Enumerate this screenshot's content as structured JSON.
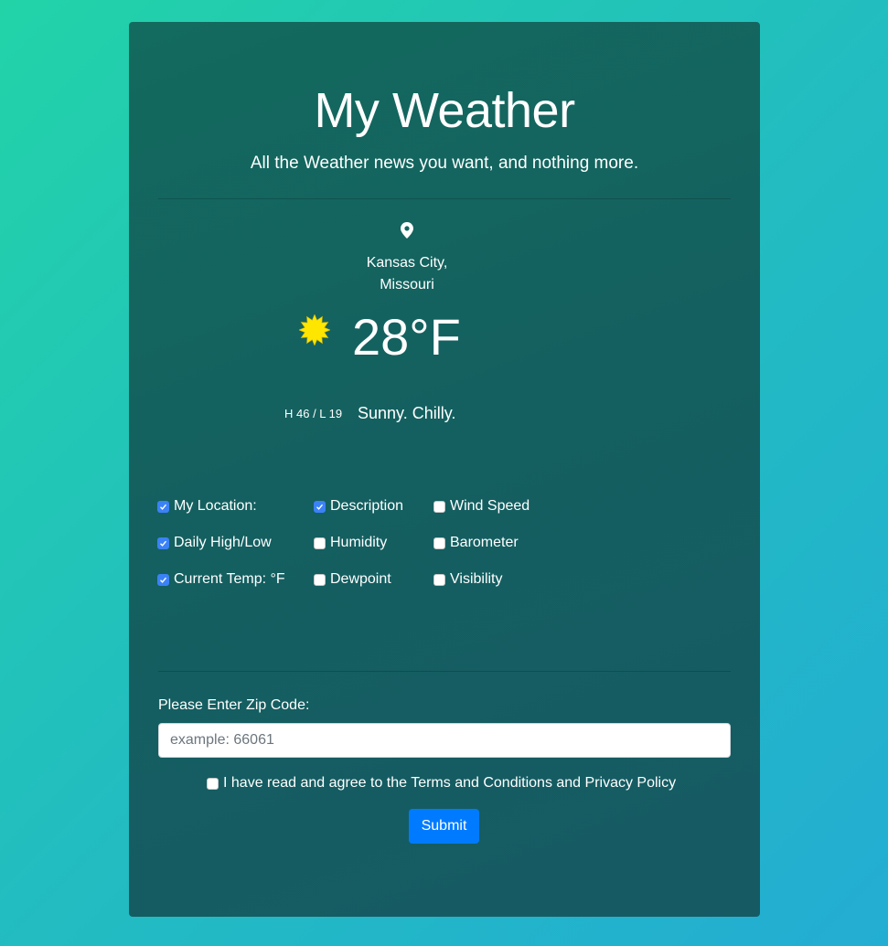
{
  "header": {
    "title": "My Weather",
    "subtitle": "All the Weather news you want, and nothing more."
  },
  "weather": {
    "location_icon": "map-pin-icon",
    "city": "Kansas City,",
    "state": "Missouri",
    "condition_icon": "sun-icon",
    "temperature": "28°F",
    "high_low": "H 46 / L 19",
    "description": "Sunny. Chilly."
  },
  "options": {
    "my_location": {
      "label": "My Location:",
      "checked": true
    },
    "description": {
      "label": "Description",
      "checked": true
    },
    "wind_speed": {
      "label": "Wind Speed",
      "checked": false
    },
    "daily_high_low": {
      "label": "Daily High/Low",
      "checked": true
    },
    "humidity": {
      "label": "Humidity",
      "checked": false
    },
    "barometer": {
      "label": "Barometer",
      "checked": false
    },
    "current_temp": {
      "label": "Current Temp: °F",
      "checked": true
    },
    "dewpoint": {
      "label": "Dewpoint",
      "checked": false
    },
    "visibility": {
      "label": "Visibility",
      "checked": false
    }
  },
  "form": {
    "zip_label": "Please Enter Zip Code:",
    "zip_placeholder": "example: 66061",
    "zip_value": "",
    "terms_label": "I have read and agree to the Terms and Conditions and Privacy Policy",
    "terms_checked": false,
    "submit_label": "Submit"
  },
  "colors": {
    "card": "#145f60",
    "accent": "#007bff",
    "checkbox_checked": "#3b82f6",
    "sun": "#ffe600"
  }
}
